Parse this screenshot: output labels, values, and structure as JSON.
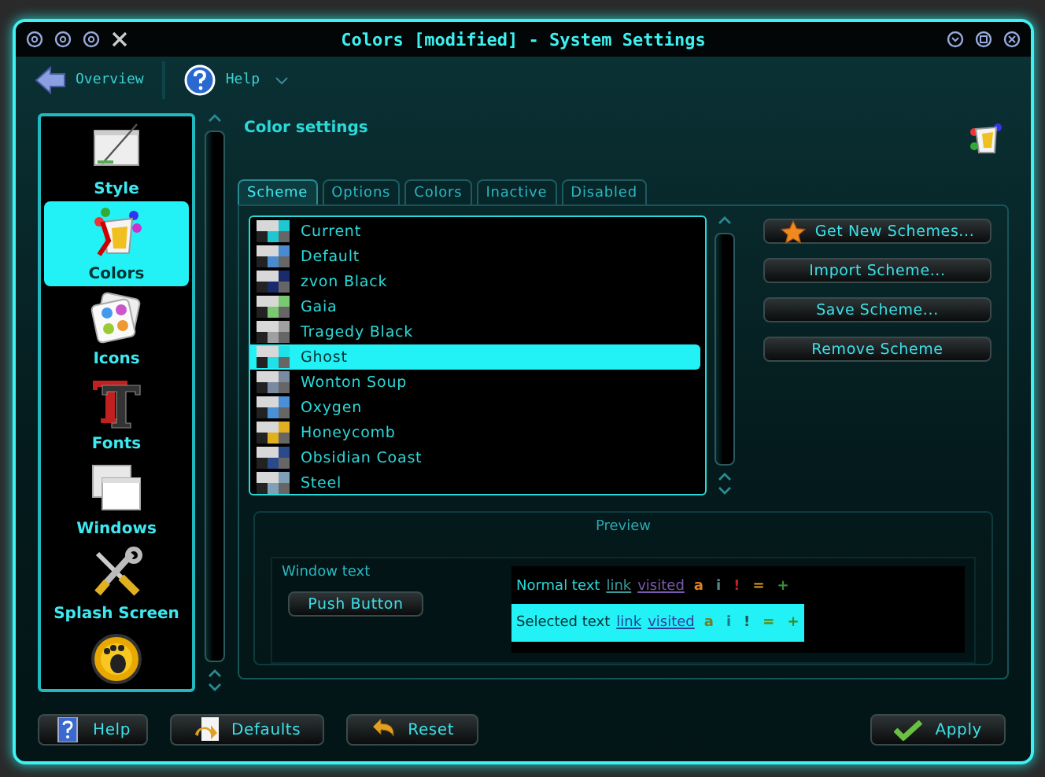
{
  "window": {
    "title": "Colors [modified] - System Settings"
  },
  "toolbar": [
    {
      "label": "Overview",
      "kind": "back"
    },
    {
      "label": "Help",
      "kind": "help"
    }
  ],
  "sidebar": {
    "items": [
      {
        "label": "Style",
        "kind": "style",
        "selected": false
      },
      {
        "label": "Colors",
        "kind": "colors",
        "selected": true
      },
      {
        "label": "Icons",
        "kind": "icons",
        "selected": false
      },
      {
        "label": "Fonts",
        "kind": "fonts",
        "selected": false
      },
      {
        "label": "Windows",
        "kind": "windows",
        "selected": false
      },
      {
        "label": "Splash Screen",
        "kind": "splash",
        "selected": false
      },
      {
        "kind": "gtk",
        "selected": false
      }
    ]
  },
  "header": "Color settings",
  "tabs": [
    {
      "label": "Scheme",
      "selected": true
    },
    {
      "label": "Options",
      "selected": false
    },
    {
      "label": "Colors",
      "selected": false
    },
    {
      "label": "Inactive",
      "selected": false
    },
    {
      "label": "Disabled",
      "selected": false
    }
  ],
  "schemes": [
    {
      "label": "Current",
      "color": "#1fc8d0",
      "selected": false
    },
    {
      "label": "Default",
      "color": "#4a8ad0",
      "selected": false
    },
    {
      "label": "zvon Black",
      "color": "#1a2a6a",
      "selected": false
    },
    {
      "label": "Gaia",
      "color": "#7ac870",
      "selected": false
    },
    {
      "label": "Tragedy Black",
      "color": "#a0a0a0",
      "selected": false
    },
    {
      "label": "Ghost",
      "color": "#20e0e8",
      "selected": true
    },
    {
      "label": "Wonton Soup",
      "color": "#7a8aa0",
      "selected": false
    },
    {
      "label": "Oxygen",
      "color": "#4a90d8",
      "selected": false
    },
    {
      "label": "Honeycomb",
      "color": "#e0b020",
      "selected": false
    },
    {
      "label": "Obsidian Coast",
      "color": "#2a4a8a",
      "selected": false
    },
    {
      "label": "Steel",
      "color": "#80a0b8",
      "selected": false
    }
  ],
  "scheme_buttons": [
    {
      "label": "Get New Schemes...",
      "kind": "star"
    },
    {
      "label": "Import Scheme...",
      "kind": "plain"
    },
    {
      "label": "Save Scheme...",
      "kind": "plain"
    },
    {
      "label": "Remove Scheme",
      "kind": "plain"
    }
  ],
  "preview": {
    "title": "Preview",
    "window_text": "Window text",
    "push_button": "Push Button",
    "normal": [
      {
        "text": "Normal text",
        "kind": "text",
        "color": "#2ad8d8"
      },
      {
        "text": "link",
        "kind": "link",
        "color": "#3a9a9a"
      },
      {
        "text": "visited",
        "kind": "link",
        "color": "#7a5ab0"
      },
      {
        "text": "a",
        "kind": "mark",
        "color": "#e08020"
      },
      {
        "text": "i",
        "kind": "mark",
        "color": "#5a8a8a"
      },
      {
        "text": "!",
        "kind": "mark",
        "color": "#c02020"
      },
      {
        "text": "=",
        "kind": "mark",
        "color": "#c09020"
      },
      {
        "text": "+",
        "kind": "mark",
        "color": "#3a8a3a"
      }
    ],
    "selected": [
      {
        "text": "Selected text",
        "kind": "text",
        "color": "#003030"
      },
      {
        "text": "link",
        "kind": "link",
        "color": "#1a4a9a"
      },
      {
        "text": "visited",
        "kind": "link",
        "color": "#3a3aa0"
      },
      {
        "text": "a",
        "kind": "mark",
        "color": "#7a7a20"
      },
      {
        "text": "i",
        "kind": "mark",
        "color": "#1a7a80"
      },
      {
        "text": "!",
        "kind": "mark",
        "color": "#1a5050"
      },
      {
        "text": "=",
        "kind": "mark",
        "color": "#5a8a10"
      },
      {
        "text": "+",
        "kind": "mark",
        "color": "#3a8a20"
      }
    ]
  },
  "bottom_buttons": [
    {
      "label": "Help",
      "kind": "help"
    },
    {
      "label": "Defaults",
      "kind": "defaults"
    },
    {
      "label": "Reset",
      "kind": "reset"
    }
  ],
  "apply": {
    "label": "Apply"
  }
}
